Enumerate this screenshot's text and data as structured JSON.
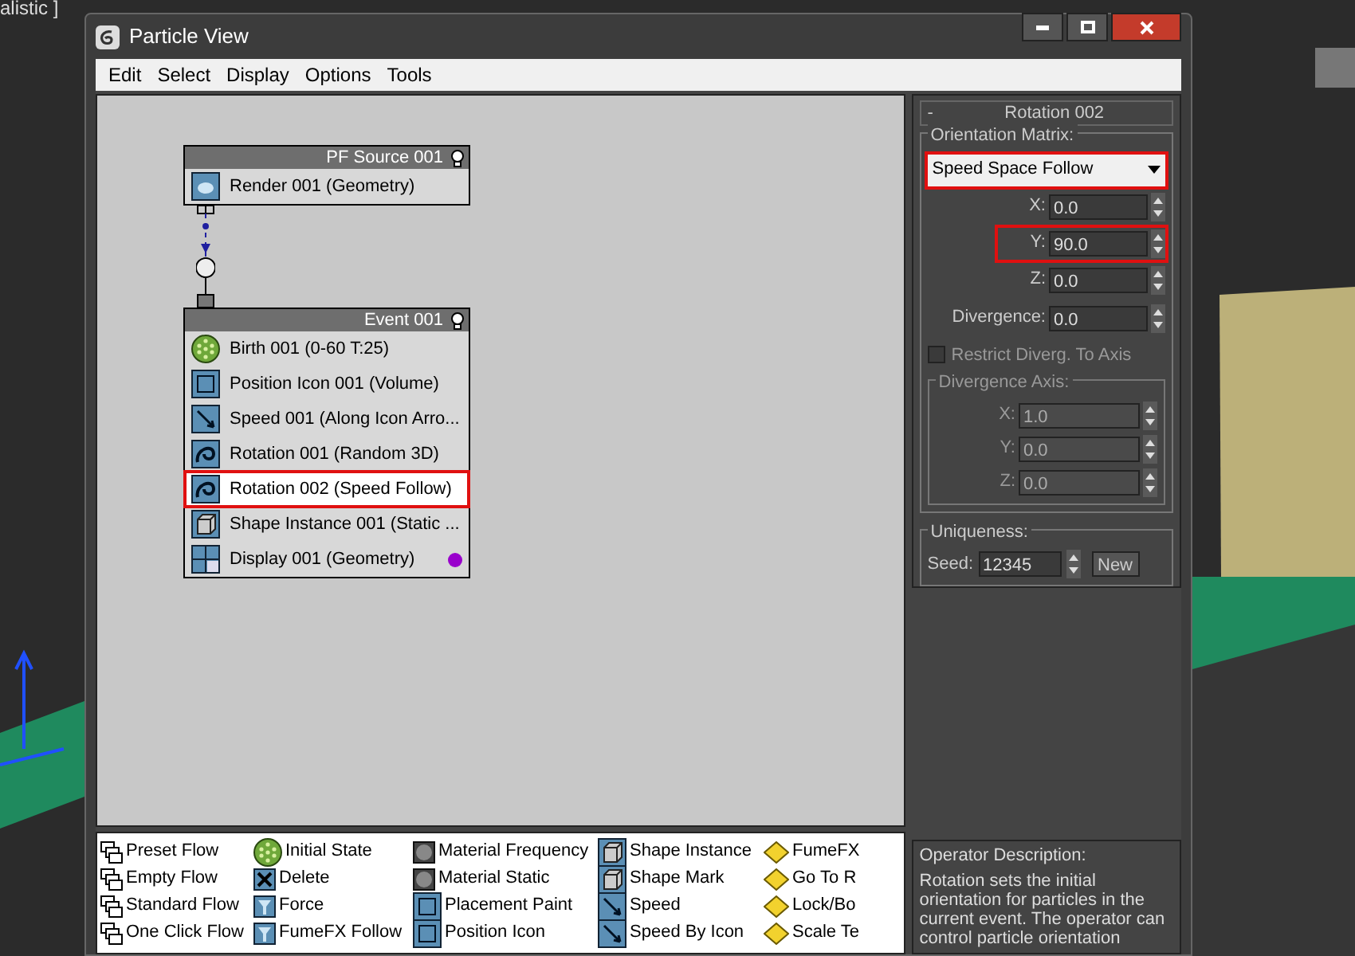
{
  "viewport": {
    "label": "alistic ]"
  },
  "window": {
    "title": "Particle View"
  },
  "menu": [
    "Edit",
    "Select",
    "Display",
    "Options",
    "Tools"
  ],
  "nodes": [
    {
      "title": "PF Source 001",
      "items": [
        {
          "label": "Render 001 (Geometry)",
          "kind": "render",
          "selected": false
        }
      ]
    },
    {
      "title": "Event 001",
      "items": [
        {
          "label": "Birth 001 (0-60 T:25)",
          "kind": "birth",
          "selected": false
        },
        {
          "label": "Position Icon 001 (Volume)",
          "kind": "position",
          "selected": false
        },
        {
          "label": "Speed 001 (Along Icon Arro...",
          "kind": "speed",
          "selected": false
        },
        {
          "label": "Rotation 001 (Random 3D)",
          "kind": "rotation",
          "selected": false
        },
        {
          "label": "Rotation 002 (Speed Follow)",
          "kind": "rotation",
          "selected": true
        },
        {
          "label": "Shape Instance 001 (Static ...",
          "kind": "shape",
          "selected": false
        },
        {
          "label": "Display 001 (Geometry)",
          "kind": "display",
          "selected": false,
          "color": "#9900cc"
        }
      ]
    }
  ],
  "rollout": {
    "title": "Rotation 002",
    "collapse": "-",
    "orientation": {
      "label": "Orientation Matrix:",
      "value": "Speed Space Follow",
      "highlighted": true,
      "axes": [
        {
          "label": "X:",
          "value": "0.0",
          "highlighted": false
        },
        {
          "label": "Y:",
          "value": "90.0",
          "highlighted": true
        },
        {
          "label": "Z:",
          "value": "0.0",
          "highlighted": false
        }
      ]
    },
    "divergence": {
      "label": "Divergence:",
      "value": "0.0"
    },
    "restrict": {
      "label": "Restrict Diverg. To Axis",
      "checked": false
    },
    "divergence_axis": {
      "label": "Divergence Axis:",
      "disabled": true,
      "axes": [
        {
          "label": "X:",
          "value": "1.0"
        },
        {
          "label": "Y:",
          "value": "0.0"
        },
        {
          "label": "Z:",
          "value": "0.0"
        }
      ]
    },
    "uniqueness": {
      "label": "Uniqueness:",
      "seed_label": "Seed:",
      "seed": "12345",
      "button": "New"
    }
  },
  "depot": [
    [
      {
        "label": "Preset Flow",
        "kind": "flow"
      },
      {
        "label": "Empty Flow",
        "kind": "flow"
      },
      {
        "label": "Standard Flow",
        "kind": "flow"
      },
      {
        "label": "One Click Flow",
        "kind": "flow"
      }
    ],
    [
      {
        "label": "Initial State",
        "kind": "state"
      },
      {
        "label": "Delete",
        "kind": "delete"
      },
      {
        "label": "Force",
        "kind": "force"
      },
      {
        "label": "FumeFX Follow",
        "kind": "force"
      }
    ],
    [
      {
        "label": "Material Frequency",
        "kind": "material"
      },
      {
        "label": "Material Static",
        "kind": "material"
      },
      {
        "label": "Placement Paint",
        "kind": "position"
      },
      {
        "label": "Position Icon",
        "kind": "position"
      }
    ],
    [
      {
        "label": "Shape Instance",
        "kind": "shape"
      },
      {
        "label": "Shape Mark",
        "kind": "shape"
      },
      {
        "label": "Speed",
        "kind": "speed"
      },
      {
        "label": "Speed By Icon",
        "kind": "speed"
      }
    ],
    [
      {
        "label": "FumeFX",
        "kind": "test"
      },
      {
        "label": "Go To R",
        "kind": "test"
      },
      {
        "label": "Lock/Bo",
        "kind": "test"
      },
      {
        "label": "Scale Te",
        "kind": "test"
      }
    ]
  ],
  "description": {
    "label": "Operator Description:",
    "text": "Rotation sets the initial orientation for particles in the current event. The operator can control particle orientation"
  }
}
